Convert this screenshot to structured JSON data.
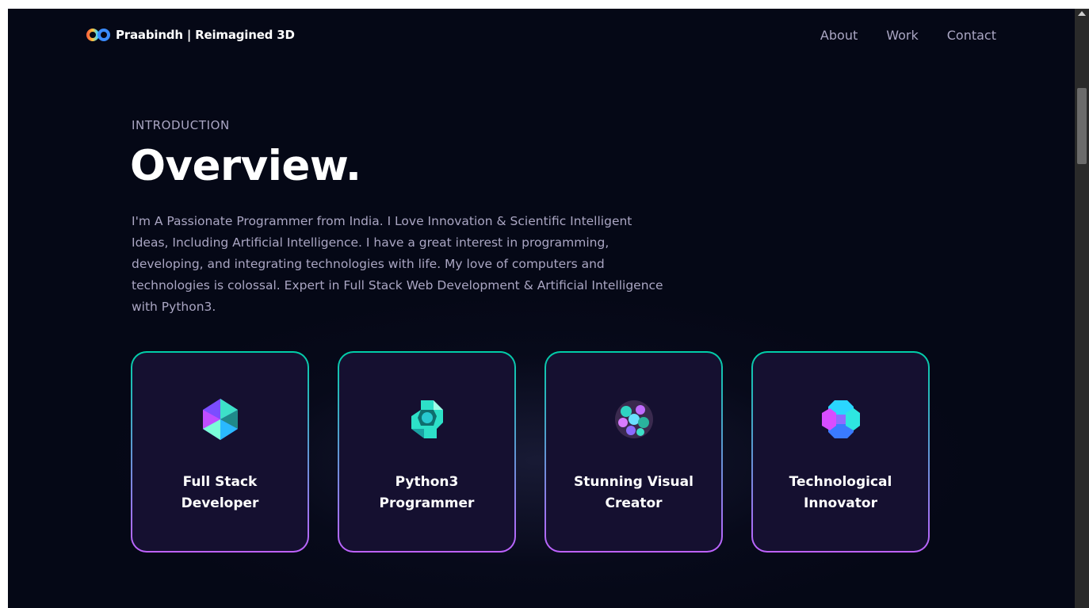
{
  "navbar": {
    "brand": "Praabindh | Reimagined 3D",
    "logo_icon": "infinity-logo-icon",
    "links": [
      {
        "label": "About"
      },
      {
        "label": "Work"
      },
      {
        "label": "Contact"
      }
    ]
  },
  "intro": {
    "subtitle": "INTRODUCTION",
    "title": "Overview.",
    "description": "I'm A Passionate Programmer from India. I Love Innovation & Scientific Intelligent Ideas, Including Artificial Intelligence. I have a great interest in programming, developing, and integrating technologies with life. My love of computers and technologies is colossal. Expert in Full Stack Web Development & Artificial Intelligence with Python3."
  },
  "cards": [
    {
      "title": "Full Stack Developer",
      "icon": "crystal-icon"
    },
    {
      "title": "Python3 Programmer",
      "icon": "cube-knot-icon"
    },
    {
      "title": "Stunning Visual Creator",
      "icon": "sphere-cluster-icon"
    },
    {
      "title": "Technological Innovator",
      "icon": "hex-cluster-icon"
    }
  ],
  "colors": {
    "background": "#050816",
    "card_background": "#151030",
    "card_border_top": "#00cea8",
    "card_border_bottom": "#bf61ff",
    "secondary_text": "#aaa6c3",
    "primary_text": "#ffffff"
  }
}
